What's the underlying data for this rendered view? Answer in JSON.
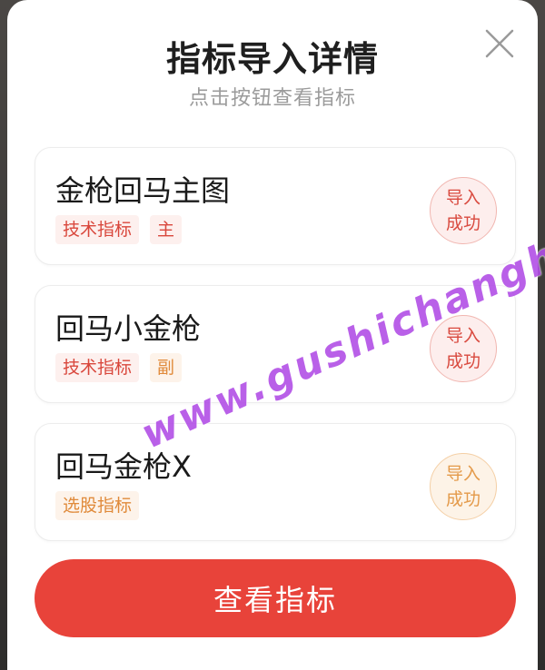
{
  "dialog": {
    "title": "指标导入详情",
    "subtitle": "点击按钮查看指标",
    "close_icon": "close-icon"
  },
  "indicators": [
    {
      "name": "金枪回马主图",
      "tags": [
        {
          "label": "技术指标",
          "color": "#d9473c"
        },
        {
          "label": "主",
          "color": "#d9473c"
        }
      ],
      "status": {
        "line1": "导入",
        "line2": "成功",
        "color": "#d94a3f"
      }
    },
    {
      "name": "回马小金枪",
      "tags": [
        {
          "label": "技术指标",
          "color": "#d9473c"
        },
        {
          "label": "副",
          "color": "#e08a3a"
        }
      ],
      "status": {
        "line1": "导入",
        "line2": "成功",
        "color": "#d94a3f"
      }
    },
    {
      "name": "回马金枪X",
      "tags": [
        {
          "label": "选股指标",
          "color": "#e08a3a"
        }
      ],
      "status": {
        "line1": "导入",
        "line2": "成功",
        "color": "#e49a4a"
      }
    }
  ],
  "action": {
    "view_label": "查看指标"
  },
  "watermark": "www.gushichanghong.com",
  "colors": {
    "primary": "#e8433a",
    "tag_red": "#d9473c",
    "tag_orange": "#e08a3a"
  }
}
